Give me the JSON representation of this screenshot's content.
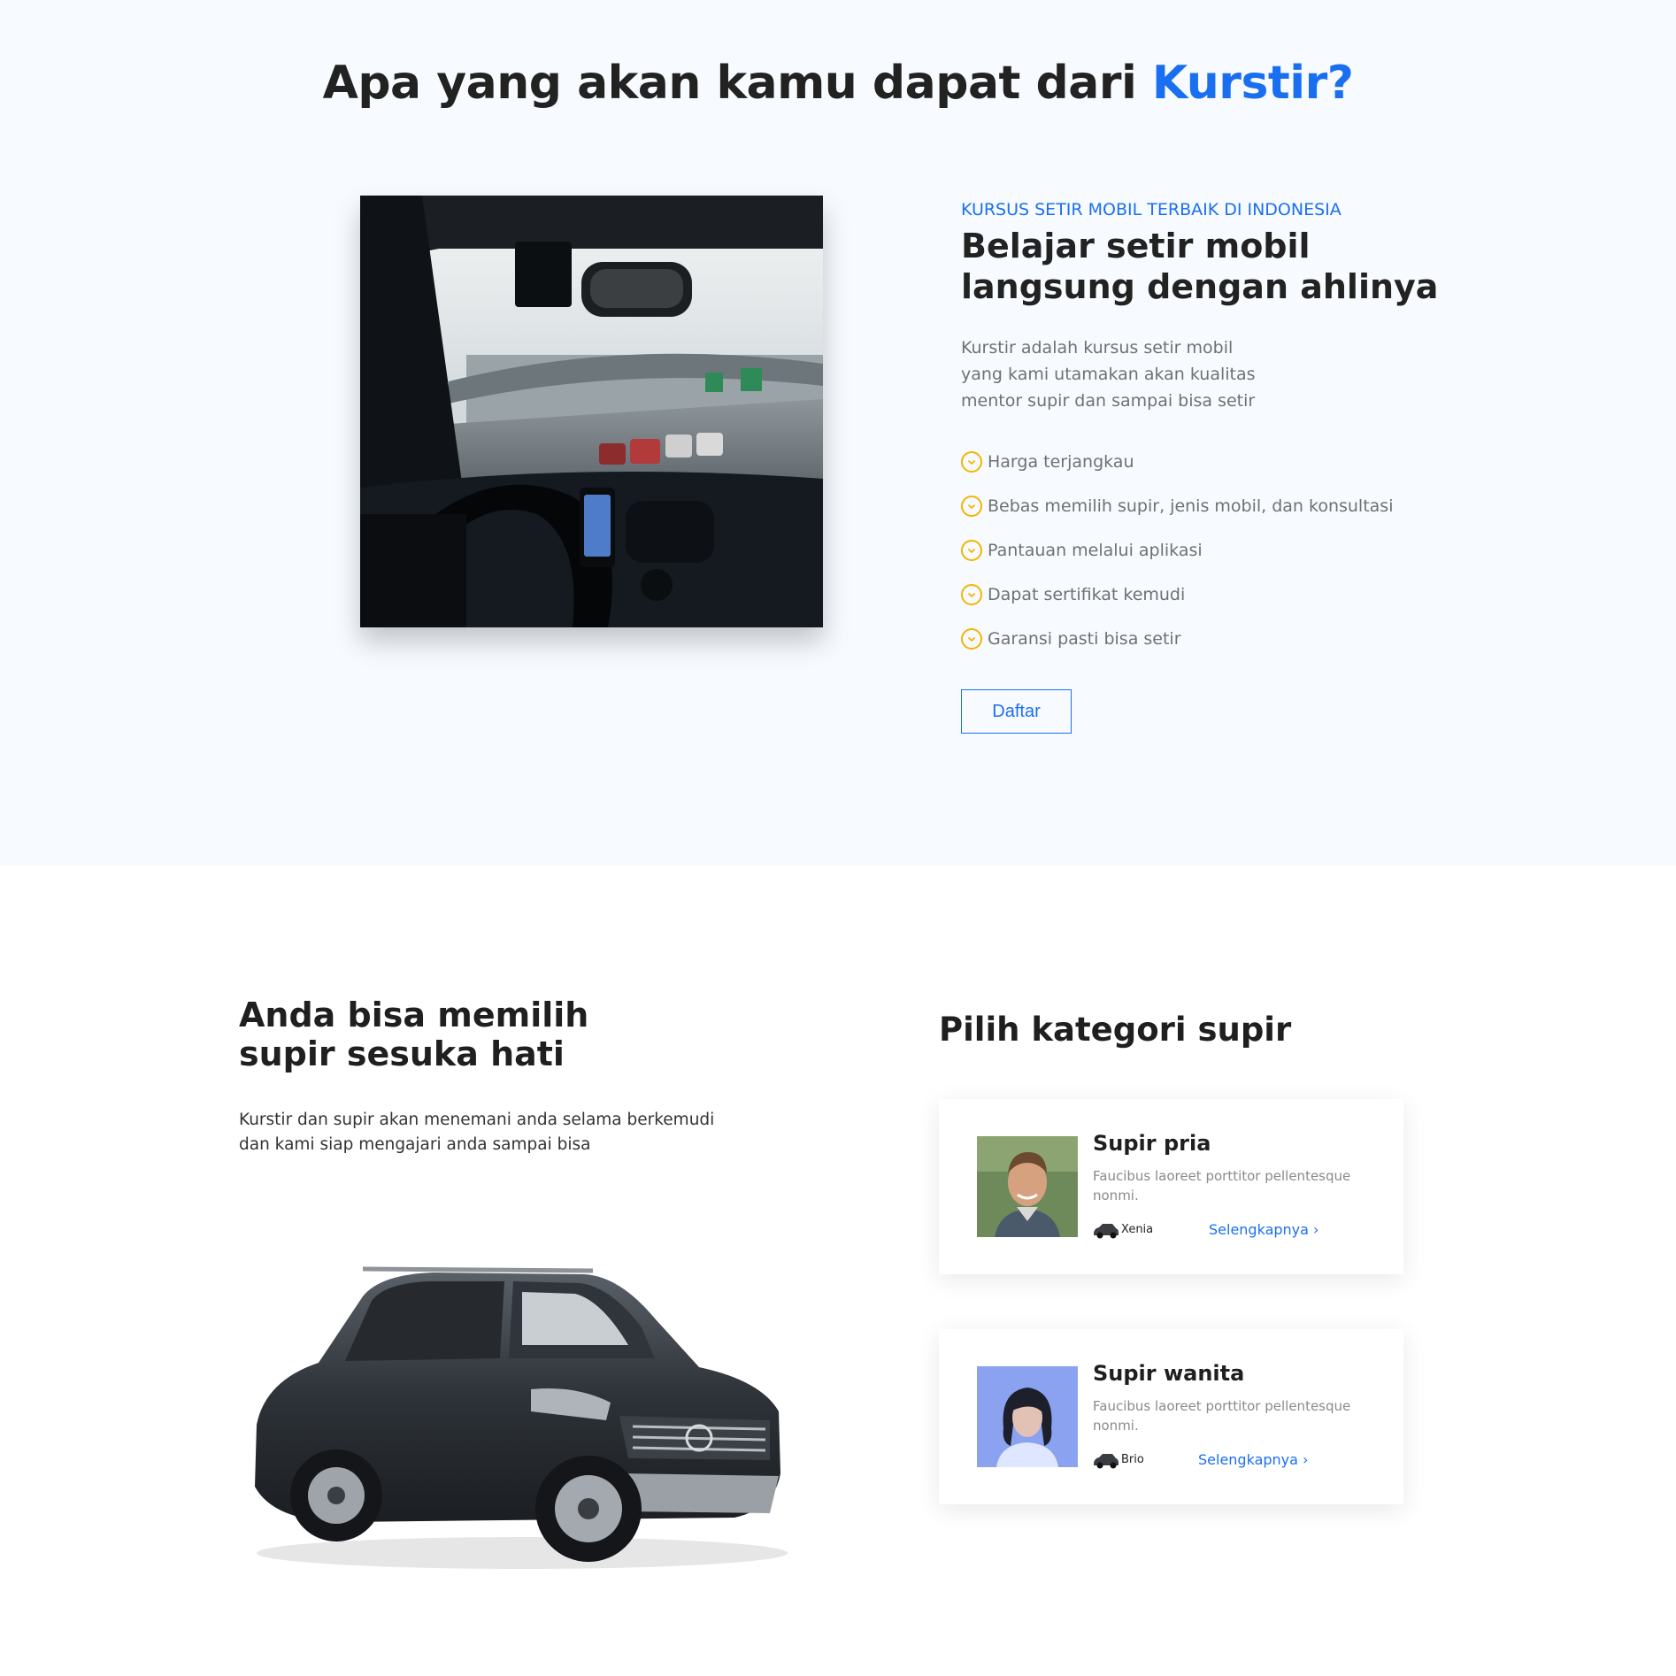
{
  "header": {
    "title_prefix": "Apa yang akan kamu dapat dari ",
    "title_accent": "Kurstir?"
  },
  "hero": {
    "kicker": "KURSUS SETIR MOBIL TERBAIK DI INDONESIA",
    "heading_line1": "Belajar setir mobil",
    "heading_line2": "langsung dengan ahlinya",
    "desc_line1": "Kurstir adalah kursus setir mobil",
    "desc_line2": "yang kami utamakan akan kualitas",
    "desc_line3": "mentor supir dan sampai bisa setir",
    "benefits": [
      "Harga terjangkau",
      "Bebas memilih supir, jenis mobil, dan konsultasi",
      "Pantauan melalui aplikasi",
      "Dapat sertifikat kemudi",
      "Garansi pasti bisa setir"
    ],
    "cta_label": "Daftar"
  },
  "drivers_intro": {
    "heading_line1": "Anda bisa memilih",
    "heading_line2": "supir sesuka hati",
    "desc_line1": "Kurstir dan supir akan menemani anda selama berkemudi",
    "desc_line2": "dan kami siap mengajari anda sampai bisa"
  },
  "categories": {
    "heading": "Pilih kategori supir",
    "cards": [
      {
        "title": "Supir pria",
        "desc": "Faucibus laoreet porttitor pellentesque nonmi.",
        "car": "Xenia",
        "link": "Selengkapnya ›"
      },
      {
        "title": "Supir wanita",
        "desc": "Faucibus laoreet porttitor pellentesque nonmi.",
        "car": "Brio",
        "link": "Selengkapnya ›"
      }
    ]
  },
  "colors": {
    "accent": "#1a6ff0",
    "check": "#f5b400",
    "section_bg": "#f7fbff"
  },
  "icons": {
    "benefit": "check-circle-icon",
    "car_mini": "car-icon"
  }
}
